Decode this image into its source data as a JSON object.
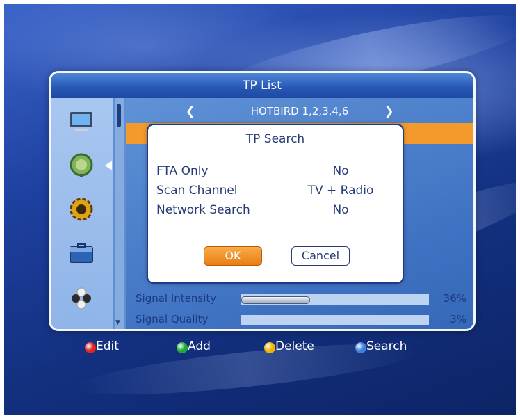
{
  "window": {
    "title": "TP List"
  },
  "satellite": {
    "name": "HOTBIRD 1,2,3,4,6",
    "prev_arrow": "❮",
    "next_arrow": "❯"
  },
  "sidebar": {
    "items": [
      {
        "icon": "tv-icon"
      },
      {
        "icon": "satellite-dish-icon",
        "selected": true
      },
      {
        "icon": "gear-icon"
      },
      {
        "icon": "toolbox-icon"
      },
      {
        "icon": "game-icon"
      }
    ]
  },
  "signal": {
    "intensity_label": "Signal Intensity",
    "intensity_value": "36%",
    "intensity_level": 0.36,
    "quality_label": "Signal Quality",
    "quality_value": "3%",
    "quality_level": 0.03
  },
  "dialog": {
    "title": "TP Search",
    "options": [
      {
        "label": "FTA Only",
        "value": "No"
      },
      {
        "label": "Scan Channel",
        "value": "TV + Radio"
      },
      {
        "label": "Network Search",
        "value": "No"
      }
    ],
    "ok_label": "OK",
    "cancel_label": "Cancel"
  },
  "legend": [
    {
      "label": "Edit",
      "color": "#e02424"
    },
    {
      "label": "Add",
      "color": "#1fa83a"
    },
    {
      "label": "Delete",
      "color": "#f0b400"
    },
    {
      "label": "Search",
      "color": "#3f7fe0"
    }
  ],
  "colors": {
    "highlight": "#f39a2d",
    "panel_border": "#f2f5fb"
  }
}
